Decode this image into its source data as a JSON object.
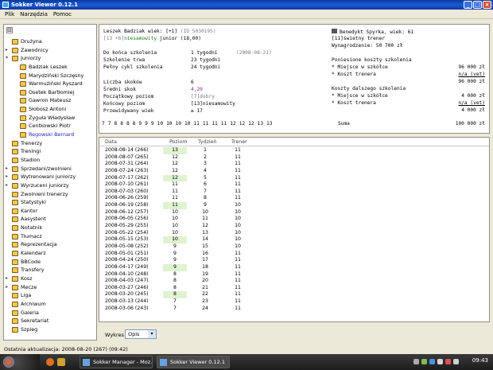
{
  "window": {
    "title": "Sokker Viewer 0.12.1"
  },
  "menu": [
    "Plik",
    "Narzędzia",
    "Pomoc"
  ],
  "sidebar": {
    "collapse_glyph": "⊟",
    "items": [
      {
        "label": "Drużyna",
        "indent": 1,
        "icon": "team-icon"
      },
      {
        "label": "Zawodnicy",
        "indent": 1,
        "icon": "players-icon"
      },
      {
        "label": "Juniorzy",
        "indent": 1,
        "icon": "juniors-icon"
      },
      {
        "label": "Badziak Leszek",
        "indent": 2,
        "icon": "junior-icon"
      },
      {
        "label": "Marydziński Szczęsny",
        "indent": 2,
        "icon": "junior-icon"
      },
      {
        "label": "Warmużiński Ryszard",
        "indent": 2,
        "icon": "junior-icon"
      },
      {
        "label": "Osetek Bartłomiej",
        "indent": 2,
        "icon": "junior-icon"
      },
      {
        "label": "Gawron Mateusz",
        "indent": 2,
        "icon": "junior-icon"
      },
      {
        "label": "Słobosz Antoni",
        "indent": 2,
        "icon": "junior-icon"
      },
      {
        "label": "Zyguła Władysław",
        "indent": 2,
        "icon": "junior-icon"
      },
      {
        "label": "Centkowski Piotr",
        "indent": 2,
        "icon": "junior-icon"
      },
      {
        "label": "Regowski Bernard",
        "indent": 2,
        "icon": "junior-icon",
        "selected": true
      },
      {
        "label": "Trenerzy",
        "indent": 1,
        "icon": "coaches-icon"
      },
      {
        "label": "Treningi",
        "indent": 1,
        "icon": "training-icon"
      },
      {
        "label": "Stadion",
        "indent": 1,
        "icon": "stadium-icon"
      },
      {
        "label": "Sprzedani/zwolnieni",
        "indent": 1,
        "icon": "sold-icon"
      },
      {
        "label": "Wytrenowani juniorzy",
        "indent": 1,
        "icon": "trained-icon"
      },
      {
        "label": "Wyrzuceni juniorzy",
        "indent": 1,
        "icon": "fired-icon"
      },
      {
        "label": "Zwolnieni trenerzy",
        "indent": 1,
        "icon": "fired-coaches-icon"
      },
      {
        "label": "Statystyki",
        "indent": 1,
        "icon": "stats-icon"
      },
      {
        "label": "Kantor",
        "indent": 1,
        "icon": "exchange-icon"
      },
      {
        "label": "Aasystent",
        "indent": 1,
        "icon": "assistant-icon"
      },
      {
        "label": "Notatnik",
        "indent": 1,
        "icon": "notebook-icon"
      },
      {
        "label": "Tłumacz",
        "indent": 1,
        "icon": "translator-icon"
      },
      {
        "label": "Reprezentacja",
        "indent": 1,
        "icon": "national-team-icon"
      },
      {
        "label": "Kalendarz",
        "indent": 1,
        "icon": "calendar-icon"
      },
      {
        "label": "BBCode",
        "indent": 1,
        "icon": "bbcode-icon"
      },
      {
        "label": "Transfery",
        "indent": 1,
        "icon": "transfers-icon"
      },
      {
        "label": "Kosz",
        "indent": 1,
        "icon": "trash-icon"
      },
      {
        "label": "Mecze",
        "indent": 1,
        "icon": "matches-icon"
      },
      {
        "label": "Liga",
        "indent": 1,
        "icon": "league-icon"
      },
      {
        "label": "Archiwum",
        "indent": 1,
        "icon": "archive-icon"
      },
      {
        "label": "Galeria",
        "indent": 1,
        "icon": "gallery-icon"
      },
      {
        "label": "Sekretariat",
        "indent": 1,
        "icon": "secretariat-icon"
      },
      {
        "label": "Szpieg",
        "indent": 1,
        "icon": "spy-icon"
      }
    ]
  },
  "junior": {
    "header": "Leszek Badziak wiek: [+1]",
    "id_text": "(ID 5030195)",
    "level_prefix": "[13 +6]",
    "level_name": "niesamowity",
    "level_suffix": "junior (18,00)",
    "rows": [
      {
        "label": "Do końca szkolenia",
        "value": "1 tygodni",
        "extra": "(2008-08-21)"
      },
      {
        "label": "Szkolenie trwa",
        "value": "23 tygodni",
        "extra": ""
      },
      {
        "label": "Pełny cykl szkolenia",
        "value": "24 tygodni",
        "extra": ""
      }
    ],
    "stats": [
      {
        "label": "Liczba skoków",
        "value": "6"
      },
      {
        "label": "Średni skok",
        "value": "4,20"
      },
      {
        "label": "Początkowy poziom",
        "value": "[7]dobry"
      },
      {
        "label": "Końcowy poziom",
        "value": "[13]niesamowity"
      },
      {
        "label": "Przewidywany wiek",
        "value": "≥ 17"
      }
    ],
    "level_sequence": [
      "7",
      "7",
      "8",
      "8",
      "8",
      "8",
      "9",
      "9",
      "9",
      "10",
      "10",
      "10",
      "10",
      "11",
      "11",
      "11",
      "11",
      "12",
      "12",
      "12",
      "13",
      "13"
    ]
  },
  "coach": {
    "name": "Benedykt Spyrka, wiek: 61",
    "level": "[11]świetny trener",
    "salary": "Wynagrodzenie: 50 700 zł",
    "costs_title": "Poniesione koszty szkolenia",
    "costs": [
      {
        "label": "* Miejsce w szkółce",
        "value": "96 000 zł"
      },
      {
        "label": "* Koszt trenera",
        "value": "n/a (vet)"
      }
    ],
    "costs_total": "96 000 zł",
    "future_title": "Koszty dalszego szkolenia",
    "future": [
      {
        "label": "* Miejsce w szkółce",
        "value": "4 000 zł"
      },
      {
        "label": "* Koszt trenera",
        "value": "n/a (vet)"
      }
    ],
    "future_total": "4 000 zł",
    "sum_label": "Suma",
    "sum_value": "100 000 zł"
  },
  "table": {
    "headers": [
      "Data",
      "Poziom",
      "Tydzień",
      "Trener"
    ],
    "rows": [
      {
        "date": "2008-08-14 (266)",
        "level": "13",
        "week": "1",
        "coach": "11",
        "hl": true
      },
      {
        "date": "2008-08-07 (265)",
        "level": "12",
        "week": "2",
        "coach": "11"
      },
      {
        "date": "2008-07-31 (264)",
        "level": "12",
        "week": "3",
        "coach": "11"
      },
      {
        "date": "2008-07-24 (263)",
        "level": "12",
        "week": "4",
        "coach": "11"
      },
      {
        "date": "2008-07-17 (262)",
        "level": "12",
        "week": "5",
        "coach": "11",
        "hl": true
      },
      {
        "date": "2008-07-10 (261)",
        "level": "11",
        "week": "6",
        "coach": "11"
      },
      {
        "date": "2008-07-03 (260)",
        "level": "11",
        "week": "7",
        "coach": "11"
      },
      {
        "date": "2008-06-26 (259)",
        "level": "11",
        "week": "8",
        "coach": "11"
      },
      {
        "date": "2008-06-19 (258)",
        "level": "11",
        "week": "9",
        "coach": "10",
        "hl": true
      },
      {
        "date": "2008-06-12 (257)",
        "level": "10",
        "week": "10",
        "coach": "10"
      },
      {
        "date": "2008-06-05 (256)",
        "level": "10",
        "week": "11",
        "coach": "10"
      },
      {
        "date": "2008-05-29 (255)",
        "level": "10",
        "week": "12",
        "coach": "10"
      },
      {
        "date": "2008-05-22 (254)",
        "level": "10",
        "week": "13",
        "coach": "10"
      },
      {
        "date": "2008-05-15 (253)",
        "level": "10",
        "week": "14",
        "coach": "10",
        "hl": true
      },
      {
        "date": "2008-05-08 (252)",
        "level": "9",
        "week": "15",
        "coach": "10"
      },
      {
        "date": "2008-05-01 (251)",
        "level": "9",
        "week": "16",
        "coach": "11"
      },
      {
        "date": "2008-04-24 (250)",
        "level": "9",
        "week": "17",
        "coach": "11"
      },
      {
        "date": "2008-04-17 (249)",
        "level": "9",
        "week": "18",
        "coach": "11",
        "hl": true
      },
      {
        "date": "2008-04-10 (248)",
        "level": "8",
        "week": "19",
        "coach": "11"
      },
      {
        "date": "2008-04-03 (247)",
        "level": "8",
        "week": "20",
        "coach": "11"
      },
      {
        "date": "2008-03-27 (246)",
        "level": "8",
        "week": "21",
        "coach": "11"
      },
      {
        "date": "2008-03-20 (245)",
        "level": "8",
        "week": "22",
        "coach": "11",
        "hl": true
      },
      {
        "date": "2008-03-13 (244)",
        "level": "7",
        "week": "23",
        "coach": "11"
      },
      {
        "date": "2008-03-06 (243)",
        "level": "7",
        "week": "24",
        "coach": "11"
      }
    ]
  },
  "chart_selector": {
    "label": "Wykres",
    "value": "Opis",
    "arrow": "▾"
  },
  "status": {
    "text": "Ostatnia aktualizacja: 2008-08-20 (267) (09:42)"
  },
  "taskbar": {
    "tasks": [
      {
        "label": "Sokker Manager - Moz...",
        "active": false
      },
      {
        "label": "Sokker Viewer 0.12.1",
        "active": true
      }
    ],
    "clock": "09:43"
  },
  "colors": {
    "accent": "#1b5bd6",
    "highlight": "#dff3d0",
    "selected_text": "#2020c0"
  }
}
